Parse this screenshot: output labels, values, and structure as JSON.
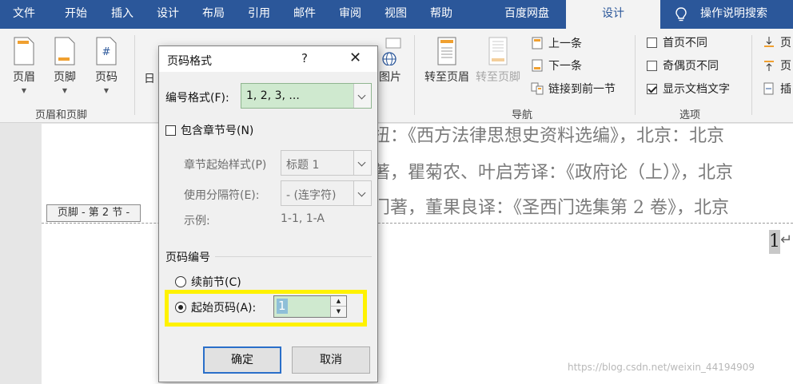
{
  "menu": {
    "tabs": [
      "文件",
      "开始",
      "插入",
      "设计",
      "布局",
      "引用",
      "邮件",
      "审阅",
      "视图",
      "帮助",
      "百度网盘",
      "设计"
    ],
    "active_tab": "设计",
    "help_search": "操作说明搜索"
  },
  "ribbon": {
    "header_footer": {
      "header_label": "页眉",
      "footer_label": "页脚",
      "page_number_label": "页码",
      "group_label": "页眉和页脚"
    },
    "insert": {
      "date_label_partial": "日",
      "picture_label": "图片"
    },
    "navigation": {
      "goto_header": "转至页眉",
      "goto_footer": "转至页脚",
      "previous": "上一条",
      "next": "下一条",
      "link_to_previous": "链接到前一节",
      "group_label": "导航"
    },
    "options": {
      "different_first_page": "首页不同",
      "different_odd_even": "奇偶页不同",
      "show_document_text": "显示文档文字",
      "group_label": "选项"
    },
    "position": {
      "item1": "页",
      "item2": "页",
      "item3": "插"
    }
  },
  "document": {
    "line1": "扭：《西方法律思想史资料选编》，北京：北京",
    "line2": "著，瞿菊农、叶启芳译：《政府论（上）》，北京",
    "line3": "门著，董果良译：《圣西门选集第 2 卷》，北京",
    "footer_tag": "页脚 - 第 2 节 -",
    "page_number": "1",
    "pilcrow": "↵",
    "watermark": "https://blog.csdn.net/weixin_44194909"
  },
  "dialog": {
    "title": "页码格式",
    "help": "?",
    "close": "✕",
    "number_format_label": "编号格式(F):",
    "number_format_value": "1, 2, 3, ...",
    "include_chapter_label": "包含章节号(N)",
    "chapter_style_label": "章节起始样式(P)",
    "chapter_style_value": "标题 1",
    "separator_label": "使用分隔符(E):",
    "separator_value": "-  (连字符)",
    "example_label": "示例:",
    "example_value": "1-1, 1-A",
    "page_numbering_section": "页码编号",
    "continue_label": "续前节(C)",
    "start_at_label": "起始页码(A):",
    "start_at_value": "1",
    "ok": "确定",
    "cancel": "取消"
  }
}
